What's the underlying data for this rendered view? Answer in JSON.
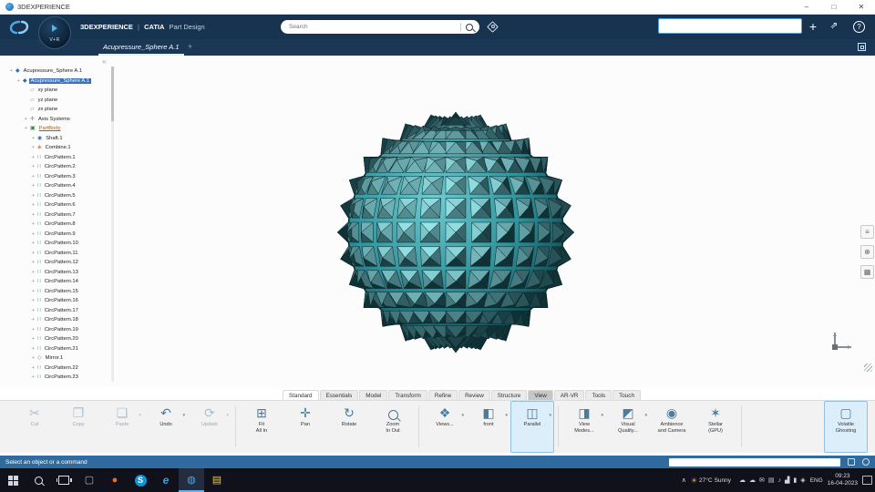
{
  "window": {
    "title": "3DEXPERIENCE"
  },
  "topbar": {
    "brand": {
      "platform": "3DEXPERIENCE",
      "separator": "|",
      "app": "CATIA",
      "role": "Part Design"
    },
    "search": {
      "placeholder": "Search",
      "value": ""
    },
    "right_search": {
      "value": ""
    },
    "compass_label": "V+R",
    "add_label": "+"
  },
  "tabbar": {
    "active_tab": "Acupressure_Sphere A.1",
    "new_tab": "+"
  },
  "tree": {
    "items": [
      {
        "label": "Acupressure_Sphere A.1",
        "type": "root",
        "depth": 0,
        "expand": true
      },
      {
        "label": "Acupressure_Sphere A.1",
        "type": "part",
        "depth": 1,
        "expand": true,
        "selected": true
      },
      {
        "label": "xy plane",
        "type": "plane",
        "depth": 2
      },
      {
        "label": "yz plane",
        "type": "plane",
        "depth": 2
      },
      {
        "label": "zx plane",
        "type": "plane",
        "depth": 2
      },
      {
        "label": "Axis Systems",
        "type": "axis",
        "depth": 2,
        "expand": true
      },
      {
        "label": "PartBody",
        "type": "body",
        "depth": 2,
        "expand": true,
        "underline": true
      },
      {
        "label": "Shaft.1",
        "type": "shaft",
        "depth": 3,
        "expand": true
      },
      {
        "label": "Combine.1",
        "type": "combine",
        "depth": 3,
        "expand": true
      },
      {
        "label": "CircPattern.1",
        "type": "pattern",
        "depth": 3,
        "expand": true
      },
      {
        "label": "CircPattern.2",
        "type": "pattern",
        "depth": 3,
        "expand": true
      },
      {
        "label": "CircPattern.3",
        "type": "pattern",
        "depth": 3,
        "expand": true
      },
      {
        "label": "CircPattern.4",
        "type": "pattern",
        "depth": 3,
        "expand": true
      },
      {
        "label": "CircPattern.5",
        "type": "pattern",
        "depth": 3,
        "expand": true
      },
      {
        "label": "CircPattern.6",
        "type": "pattern",
        "depth": 3,
        "expand": true
      },
      {
        "label": "CircPattern.7",
        "type": "pattern",
        "depth": 3,
        "expand": true
      },
      {
        "label": "CircPattern.8",
        "type": "pattern",
        "depth": 3,
        "expand": true
      },
      {
        "label": "CircPattern.9",
        "type": "pattern",
        "depth": 3,
        "expand": true
      },
      {
        "label": "CircPattern.10",
        "type": "pattern",
        "depth": 3,
        "expand": true
      },
      {
        "label": "CircPattern.11",
        "type": "pattern",
        "depth": 3,
        "expand": true
      },
      {
        "label": "CircPattern.12",
        "type": "pattern",
        "depth": 3,
        "expand": true
      },
      {
        "label": "CircPattern.13",
        "type": "pattern",
        "depth": 3,
        "expand": true
      },
      {
        "label": "CircPattern.14",
        "type": "pattern",
        "depth": 3,
        "expand": true
      },
      {
        "label": "CircPattern.15",
        "type": "pattern",
        "depth": 3,
        "expand": true
      },
      {
        "label": "CircPattern.16",
        "type": "pattern",
        "depth": 3,
        "expand": true
      },
      {
        "label": "CircPattern.17",
        "type": "pattern",
        "depth": 3,
        "expand": true
      },
      {
        "label": "CircPattern.18",
        "type": "pattern",
        "depth": 3,
        "expand": true
      },
      {
        "label": "CircPattern.19",
        "type": "pattern",
        "depth": 3,
        "expand": true
      },
      {
        "label": "CircPattern.20",
        "type": "pattern",
        "depth": 3,
        "expand": true
      },
      {
        "label": "CircPattern.21",
        "type": "pattern",
        "depth": 3,
        "expand": true
      },
      {
        "label": "Mirror.1",
        "type": "mirror",
        "depth": 3,
        "expand": true
      },
      {
        "label": "CircPattern.22",
        "type": "pattern",
        "depth": 3,
        "expand": true
      },
      {
        "label": "CircPattern.23",
        "type": "pattern",
        "depth": 3,
        "expand": true
      }
    ]
  },
  "viewport": {
    "side_tools": [
      {
        "icon": "panels-icon"
      },
      {
        "icon": "locate-icon"
      },
      {
        "icon": "grid-icon"
      }
    ],
    "model_colors": {
      "teal_mid": "#2e9098",
      "teal_light": "#8fe0e4",
      "teal_dark": "#07262a"
    }
  },
  "ribbon": {
    "tabs": [
      {
        "label": "Standard",
        "state": "active"
      },
      {
        "label": "Essentials"
      },
      {
        "label": "Model"
      },
      {
        "label": "Transform"
      },
      {
        "label": "Refine"
      },
      {
        "label": "Review"
      },
      {
        "label": "Structure"
      },
      {
        "label": "View",
        "state": "selected"
      },
      {
        "label": "AR-VR"
      },
      {
        "label": "Tools"
      },
      {
        "label": "Touch"
      }
    ],
    "groups": [
      {
        "name": "edit",
        "buttons": [
          {
            "label": "Cut",
            "icon": "scissors-icon",
            "disabled": true
          },
          {
            "label": "Copy",
            "icon": "copy-icon",
            "disabled": true
          },
          {
            "label": "Paste",
            "icon": "paste-icon",
            "disabled": true,
            "dropdown": true
          },
          {
            "label": "Undo",
            "icon": "undo-icon",
            "dropdown": true
          },
          {
            "label": "Update",
            "icon": "update-icon",
            "disabled": true,
            "dropdown": true
          }
        ]
      },
      {
        "name": "navigate",
        "buttons": [
          {
            "label": "Fit\nAll In",
            "icon": "fit-all-icon"
          },
          {
            "label": "Pan",
            "icon": "pan-icon"
          },
          {
            "label": "Rotate",
            "icon": "rotate-icon"
          },
          {
            "label": "Zoom\nIn Out",
            "icon": "magnifier-icon"
          }
        ]
      },
      {
        "name": "views",
        "buttons": [
          {
            "label": "Views...",
            "icon": "views-icon",
            "dropdown": true
          },
          {
            "label": "front",
            "icon": "front-view-icon",
            "dropdown": true
          },
          {
            "label": "Parallel",
            "icon": "parallel-icon",
            "selected": true,
            "dropdown": true
          }
        ]
      },
      {
        "name": "render",
        "buttons": [
          {
            "label": "View\nModes...",
            "icon": "view-modes-icon",
            "dropdown": true
          },
          {
            "label": "Visual\nQuality...",
            "icon": "visual-quality-icon",
            "dropdown": true
          },
          {
            "label": "Ambience\nand Camera",
            "icon": "ambience-camera-icon"
          },
          {
            "label": "Stellar\n(GPU)",
            "icon": "stellar-icon"
          }
        ]
      },
      {
        "name": "ghosting",
        "buttons": [
          {
            "label": "Volatile\nGhosting",
            "icon": "volatile-ghosting-icon",
            "selected": true
          }
        ]
      }
    ]
  },
  "statusbar": {
    "message": "Select an object or a command",
    "command_value": ""
  },
  "taskbar": {
    "apps": [
      {
        "icon": "app-window-icon"
      },
      {
        "icon": "browser-icon"
      },
      {
        "icon": "skype-icon",
        "letter": "S"
      },
      {
        "icon": "edge-icon",
        "letter": "e"
      },
      {
        "icon": "3dexperience-icon",
        "active": true
      },
      {
        "icon": "file-explorer-icon"
      }
    ],
    "tray": {
      "weather_temp": "27°C",
      "weather_desc": "Sunny",
      "icons": [
        "cloud-icon",
        "onedrive-icon",
        "mail-icon",
        "display-icon",
        "volume-icon",
        "network-icon",
        "battery-icon",
        "shield-icon"
      ],
      "lang": "ENG",
      "time": "09:23",
      "date": "16-04-2023"
    }
  }
}
